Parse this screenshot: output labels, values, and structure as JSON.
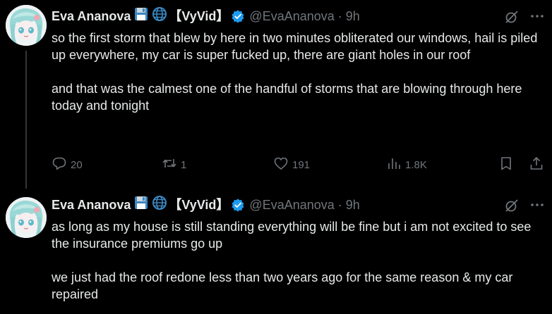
{
  "colors": {
    "background": "#000000",
    "text": "#e7e9ea",
    "secondary": "#71767b",
    "verified": "#1d9bf0",
    "thread_line": "#333639"
  },
  "tweets": [
    {
      "author": {
        "name": "Eva Ananova",
        "tag": "【VyVid】",
        "handle": "@EvaAnanova",
        "emojis": [
          "floppy-disk-emoji",
          "globe-emoji"
        ],
        "verified": true
      },
      "separator": "·",
      "time": "9h",
      "icons": [
        "grok-icon",
        "more-icon"
      ],
      "text": "so the first storm that blew by here in two minutes obliterated our windows, hail is piled up everywhere, my car is super fucked up, there are giant holes in our roof\n\nand that was the calmest one of the handful of storms that are blowing through here today and tonight",
      "actions": {
        "replies": "20",
        "reposts": "1",
        "likes": "191",
        "views": "1.8K"
      }
    },
    {
      "author": {
        "name": "Eva Ananova",
        "tag": "【VyVid】",
        "handle": "@EvaAnanova",
        "emojis": [
          "floppy-disk-emoji",
          "globe-emoji"
        ],
        "verified": true
      },
      "separator": "·",
      "time": "9h",
      "icons": [
        "grok-icon",
        "more-icon"
      ],
      "text": "as long as my house is still standing everything will be fine but i am not excited to see the insurance premiums go up\n\nwe just had the roof redone less than two years ago for the same reason & my car repaired"
    }
  ]
}
